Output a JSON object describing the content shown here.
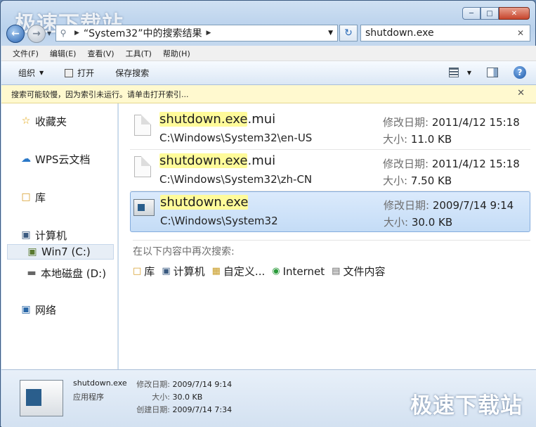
{
  "watermark": "极速下载站",
  "address": {
    "path": "“System32”中的搜索结果"
  },
  "search": {
    "value": "shutdown.exe"
  },
  "menu": [
    "文件(F)",
    "编辑(E)",
    "查看(V)",
    "工具(T)",
    "帮助(H)"
  ],
  "toolbar": {
    "organize": "组织",
    "open": "打开",
    "save_search": "保存搜索"
  },
  "infobar": {
    "message": "搜索可能较慢，因为索引未运行。请单击打开索引..."
  },
  "nav": {
    "favorites": "收藏夹",
    "wps": "WPS云文档",
    "library": "库",
    "computer": "计算机",
    "drive_c": "Win7 (C:)",
    "drive_d": "本地磁盘 (D:)",
    "network": "网络"
  },
  "labels": {
    "modified": "修改日期:",
    "size": "大小:"
  },
  "results": [
    {
      "name_match": "shutdown.exe",
      "name_rest": ".mui",
      "path": "C:\\Windows\\System32\\en-US",
      "modified": "2011/4/12 15:18",
      "size": "11.0 KB"
    },
    {
      "name_match": "shutdown.exe",
      "name_rest": ".mui",
      "path": "C:\\Windows\\System32\\zh-CN",
      "modified": "2011/4/12 15:18",
      "size": "7.50 KB"
    },
    {
      "name_match": "shutdown.exe",
      "name_rest": "",
      "path": "C:\\Windows\\System32",
      "modified": "2009/7/14 9:14",
      "size": "30.0 KB"
    }
  ],
  "search_again": {
    "title": "在以下内容中再次搜索:",
    "library": "库",
    "computer": "计算机",
    "custom": "自定义...",
    "internet": "Internet",
    "file_contents": "文件内容"
  },
  "details": {
    "name": "shutdown.exe",
    "type": "应用程序",
    "modified_label": "修改日期:",
    "modified": "2009/7/14 9:14",
    "size_label": "大小:",
    "size": "30.0 KB",
    "created_label": "创建日期:",
    "created": "2009/7/14 7:34"
  }
}
